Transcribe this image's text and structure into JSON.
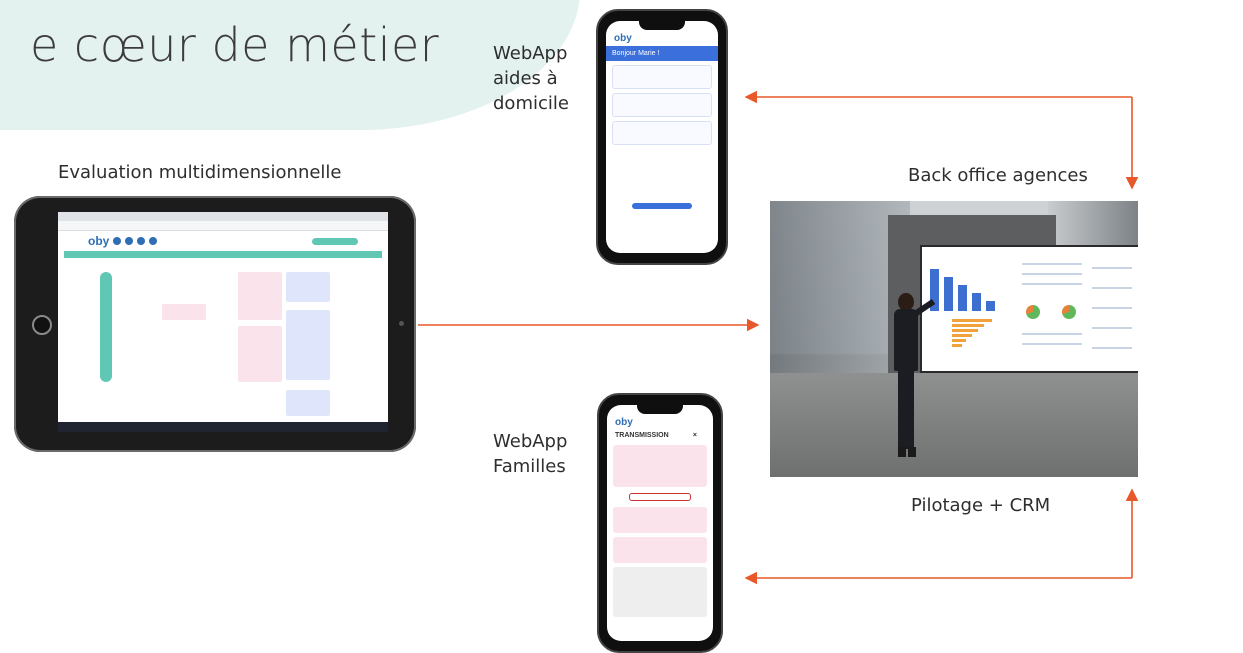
{
  "slide": {
    "title": "e cœur de métier",
    "tablet_label": "Evaluation multidimensionnelle",
    "webapp_aides": [
      "WebApp",
      "aides à",
      "domicile"
    ],
    "webapp_familles": [
      "WebApp",
      "Familles"
    ],
    "back_office": "Back office agences",
    "pilotage": "Pilotage + CRM"
  },
  "phone_top": {
    "logo": "oby",
    "header": "Bonjour Marie !"
  },
  "phone_bottom": {
    "logo": "oby",
    "title": "TRANSMISSION",
    "close": "×"
  },
  "tablet": {
    "logo": "oby"
  },
  "colors": {
    "accent": "#e8582a",
    "teal": "#e3f1ef",
    "brand_blue": "#2f6eb5"
  }
}
